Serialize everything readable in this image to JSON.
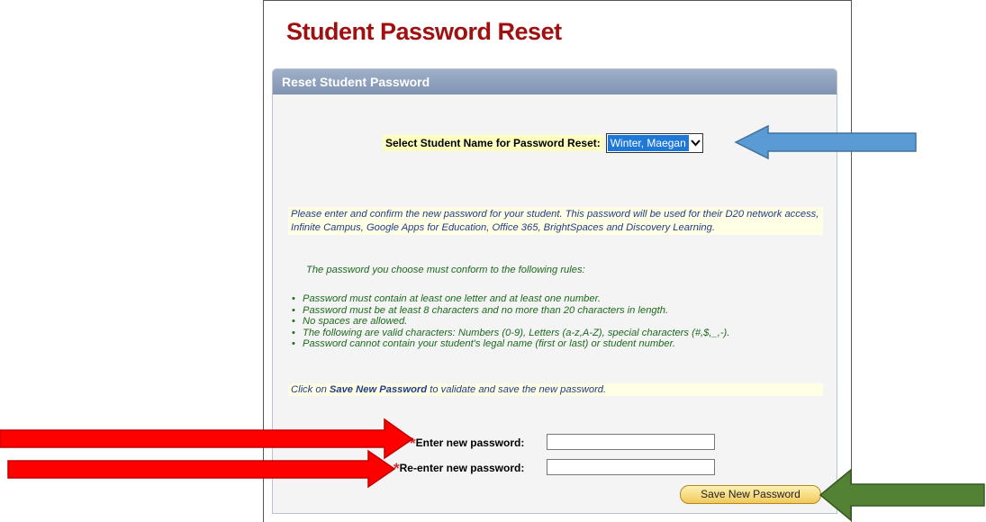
{
  "page": {
    "title": "Student Password Reset"
  },
  "panel": {
    "header": "Reset Student Password"
  },
  "student_select": {
    "label": "Select Student Name for Password Reset:",
    "selected": "Winter, Maegan"
  },
  "instructions": {
    "intro": "Please enter and confirm the new password for your student. This password will be used for their D20 network access, Infinite Campus, Google Apps for Education, Office 365, BrightSpaces and Discovery Learning.",
    "rules_intro": "The password you choose must conform to the following rules:",
    "rules": [
      "Password must contain at least one letter and at least one number.",
      "Password must be at least 8 characters and no more than 20 characters in length.",
      "No spaces are allowed.",
      "The following are valid characters: Numbers (0-9), Letters (a-z,A-Z), special characters (#,$,_,-).",
      "Password cannot contain your student's legal name (first or last) or student number."
    ],
    "click_prefix": "Click on ",
    "click_emph": "Save New Password",
    "click_suffix": " to validate and save the new password."
  },
  "form": {
    "required_mark": "*",
    "new_password_label": "Enter new password:",
    "new_password_value": "",
    "confirm_password_label": "Re-enter new password:",
    "confirm_password_value": "",
    "save_label": "Save New Password"
  },
  "colors": {
    "title": "#a01010",
    "header_bg": "#8fa2be",
    "select_highlight": "#1e78d7",
    "arrow_blue": "#5b9bd5",
    "arrow_red": "#ff0000",
    "arrow_green": "#548235"
  }
}
